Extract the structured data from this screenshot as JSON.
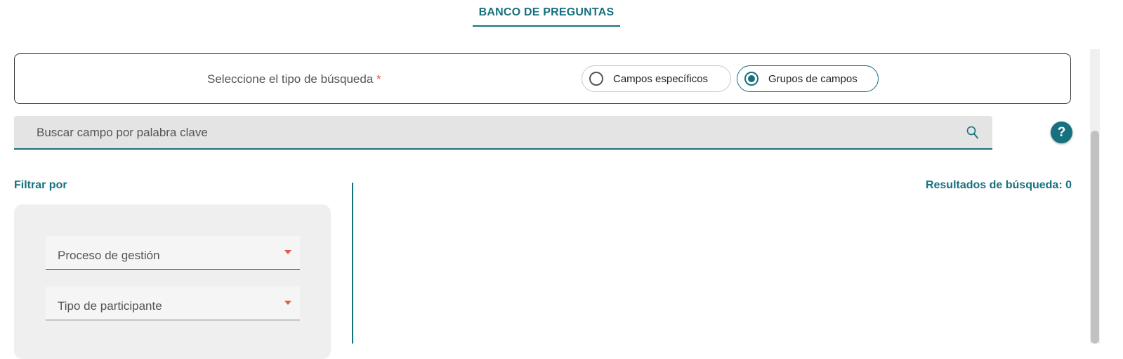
{
  "header": {
    "title": "BANCO DE PREGUNTAS"
  },
  "search_type": {
    "label": "Seleccione el tipo de búsqueda",
    "required_mark": "*",
    "options": [
      {
        "label": "Campos específicos",
        "selected": false
      },
      {
        "label": "Grupos de campos",
        "selected": true
      }
    ]
  },
  "search": {
    "placeholder": "Buscar campo por palabra clave",
    "value": ""
  },
  "help": {
    "label": "?"
  },
  "filters": {
    "title": "Filtrar por",
    "selects": [
      {
        "label": "Proceso de gestión"
      },
      {
        "label": "Tipo de participante"
      }
    ]
  },
  "results": {
    "label": "Resultados de búsqueda: 0"
  },
  "colors": {
    "accent": "#17707e",
    "required": "#e05a45",
    "panel": "#efefef"
  }
}
